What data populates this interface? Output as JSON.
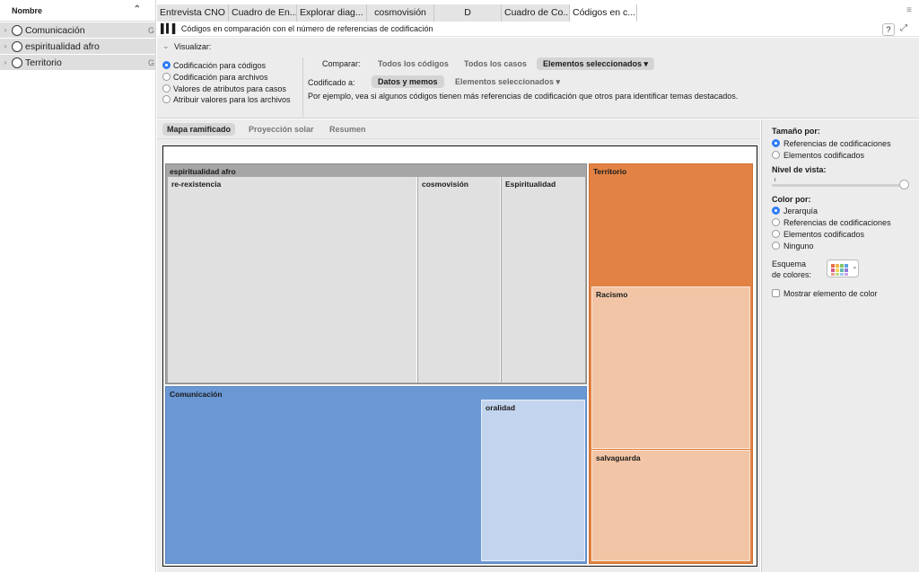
{
  "left_panel": {
    "header": "Nombre",
    "items": [
      {
        "label": "Comunicación",
        "suffix": "G"
      },
      {
        "label": "espiritualidad afro",
        "suffix": ""
      },
      {
        "label": "Territorio",
        "suffix": "G"
      }
    ]
  },
  "tabs": [
    {
      "label": "Entrevista CNO",
      "active": false
    },
    {
      "label": "Cuadro de En...",
      "active": false
    },
    {
      "label": "Explorar diag...",
      "active": false
    },
    {
      "label": "cosmovisión",
      "active": false
    },
    {
      "label": "D",
      "active": false
    },
    {
      "label": "Cuadro de Co...",
      "active": false
    },
    {
      "label": "Códigos en c...",
      "active": true
    }
  ],
  "title": "Códigos en comparación con el número de referencias de codificación",
  "help_label": "?",
  "visualize": {
    "label": "Visualizar:",
    "options": [
      {
        "label": "Codificación para códigos",
        "selected": true
      },
      {
        "label": "Codificación para archivos",
        "selected": false
      },
      {
        "label": "Valores de atributos para casos",
        "selected": false
      },
      {
        "label": "Atribuir valores para los archivos",
        "selected": false
      }
    ]
  },
  "compare": {
    "label": "Comparar:",
    "opt1": "Todos los códigos",
    "opt2": "Todos los casos",
    "opt3": "Elementos seleccionados ▾"
  },
  "coded": {
    "label": "Codificado a:",
    "opt1": "Datos y memos",
    "opt2": "Elementos seleccionados ▾"
  },
  "description": "Por ejemplo, vea si algunos códigos tienen más referencias de codificación que otros para identificar temas destacados.",
  "view_tabs": [
    "Mapa ramificado",
    "Proyección solar",
    "Resumen"
  ],
  "treemap": {
    "espiritualidad_afro": "espiritualidad afro",
    "re_rexistencia": "re-rexistencia",
    "cosmovision": "cosmovisión",
    "espiritualidad": "Espiritualidad",
    "comunicacion": "Comunicación",
    "oralidad": "oralidad",
    "territorio": "Territorio",
    "racismo": "Racismo",
    "salvaguarda": "salvaguarda"
  },
  "colors": {
    "grey_parent": "#a6a6a6",
    "grey_child": "#e0e0e0",
    "blue_parent": "#6a98d4",
    "blue_child": "#c3d5ee",
    "orange_parent": "#e28344",
    "orange_child": "#f1c5a6",
    "accent": "#2e7cf6"
  },
  "right_panel": {
    "size_by_label": "Tamaño por:",
    "size_options": [
      {
        "label": "Referencias de codificaciones",
        "selected": true
      },
      {
        "label": "Elementos codificados",
        "selected": false
      }
    ],
    "view_level_label": "Nivel de vista:",
    "color_by_label": "Color por:",
    "color_options": [
      {
        "label": "Jerarquía",
        "selected": true
      },
      {
        "label": "Referencias de codificaciones",
        "selected": false
      },
      {
        "label": "Elementos codificados",
        "selected": false
      },
      {
        "label": "Ninguno",
        "selected": false
      }
    ],
    "scheme_label_1": "Esquema",
    "scheme_label_2": "de colores:",
    "show_color_label": "Mostrar elemento de color"
  }
}
